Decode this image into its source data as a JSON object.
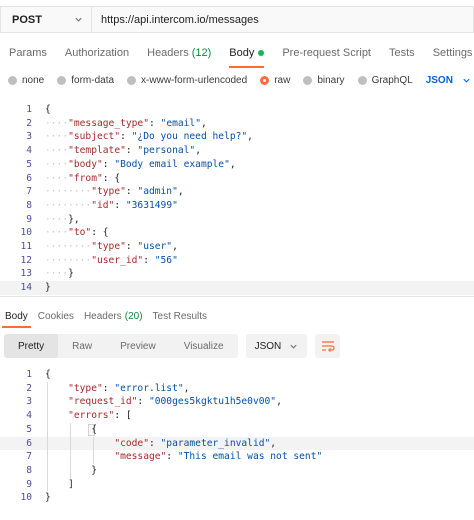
{
  "request": {
    "method": "POST",
    "url": "https://api.intercom.io/messages"
  },
  "request_tabs": [
    {
      "label": "Params"
    },
    {
      "label": "Authorization"
    },
    {
      "label": "Headers",
      "count": "(12)"
    },
    {
      "label": "Body"
    },
    {
      "label": "Pre-request Script"
    },
    {
      "label": "Tests"
    },
    {
      "label": "Settings"
    }
  ],
  "body_types": [
    {
      "label": "none"
    },
    {
      "label": "form-data"
    },
    {
      "label": "x-www-form-urlencoded"
    },
    {
      "label": "raw",
      "selected": true
    },
    {
      "label": "binary"
    },
    {
      "label": "GraphQL"
    }
  ],
  "body_language": "JSON",
  "request_body_lines": [
    {
      "n": "1",
      "indent": "",
      "key": "",
      "value": "",
      "text": "{"
    },
    {
      "n": "2",
      "indent": "····",
      "key": "\"message_type\"",
      "value": "\"email\"",
      "text": ","
    },
    {
      "n": "3",
      "indent": "····",
      "key": "\"subject\"",
      "value": "\"¿Do you need help?\"",
      "text": ","
    },
    {
      "n": "4",
      "indent": "····",
      "key": "\"template\"",
      "value": "\"personal\"",
      "text": ","
    },
    {
      "n": "5",
      "indent": "····",
      "key": "\"body\"",
      "value": "\"Body email example\"",
      "text": ","
    },
    {
      "n": "6",
      "indent": "····",
      "key": "\"from\"",
      "value": "",
      "text": " {"
    },
    {
      "n": "7",
      "indent": "········",
      "key": "\"type\"",
      "value": "\"admin\"",
      "text": ","
    },
    {
      "n": "8",
      "indent": "········",
      "key": "\"id\"",
      "value": "\"3631499\"",
      "text": ""
    },
    {
      "n": "9",
      "indent": "····",
      "key": "",
      "value": "",
      "text": "},"
    },
    {
      "n": "10",
      "indent": "····",
      "key": "\"to\"",
      "value": "",
      "text": " {"
    },
    {
      "n": "11",
      "indent": "········",
      "key": "\"type\"",
      "value": "\"user\"",
      "text": ","
    },
    {
      "n": "12",
      "indent": "········",
      "key": "\"user_id\"",
      "value": "\"56\"",
      "text": ""
    },
    {
      "n": "13",
      "indent": "····",
      "key": "",
      "value": "",
      "text": "}"
    },
    {
      "n": "14",
      "indent": "",
      "key": "",
      "value": "",
      "text": "}"
    }
  ],
  "response_tabs": [
    {
      "label": "Body"
    },
    {
      "label": "Cookies"
    },
    {
      "label": "Headers",
      "count": "(20)"
    },
    {
      "label": "Test Results"
    }
  ],
  "response_views": [
    {
      "label": "Pretty"
    },
    {
      "label": "Raw"
    },
    {
      "label": "Preview"
    },
    {
      "label": "Visualize"
    }
  ],
  "response_format": "JSON",
  "response_body_lines": [
    {
      "n": "1",
      "indent": "",
      "key": "",
      "value": "",
      "text": "{"
    },
    {
      "n": "2",
      "indent": "    ",
      "key": "\"type\"",
      "value": "\"error.list\"",
      "text": ","
    },
    {
      "n": "3",
      "indent": "    ",
      "key": "\"request_id\"",
      "value": "\"000ges5kgktu1h5e0v00\"",
      "text": ","
    },
    {
      "n": "4",
      "indent": "    ",
      "key": "\"errors\"",
      "value": "",
      "text": " ["
    },
    {
      "n": "5",
      "indent": "        ",
      "key": "",
      "value": "",
      "text": "{"
    },
    {
      "n": "6",
      "indent": "            ",
      "key": "\"code\"",
      "value": "\"parameter_invalid\"",
      "text": ","
    },
    {
      "n": "7",
      "indent": "            ",
      "key": "\"message\"",
      "value": "\"This email was not sent\"",
      "text": ""
    },
    {
      "n": "8",
      "indent": "        ",
      "key": "",
      "value": "",
      "text": "}"
    },
    {
      "n": "9",
      "indent": "    ",
      "key": "",
      "value": "",
      "text": "]"
    },
    {
      "n": "10",
      "indent": "",
      "key": "",
      "value": "",
      "text": "}"
    }
  ],
  "colors": {
    "accent": "#ff6c37",
    "json_key": "#a52a2a",
    "json_string": "#0451a5",
    "link_blue": "#0265d2",
    "count_green": "#0c8a3e"
  }
}
